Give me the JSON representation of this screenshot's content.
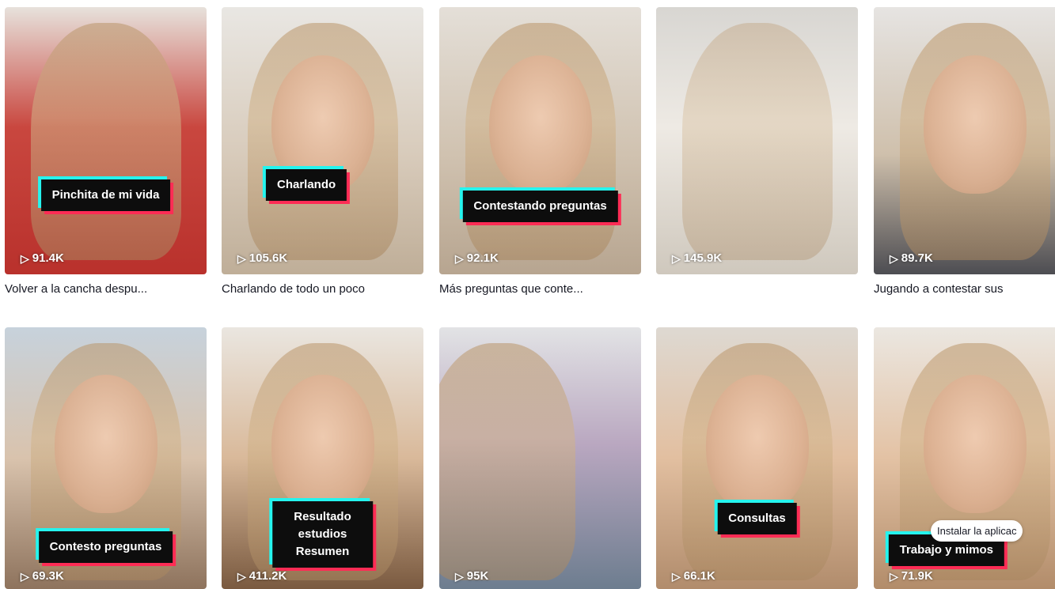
{
  "videos": [
    {
      "sticker": "Pinchita de mi vida",
      "views": "91.4K",
      "desc": "Volver a la cancha despu..."
    },
    {
      "sticker": "Charlando",
      "views": "105.6K",
      "desc": "Charlando de todo un poco"
    },
    {
      "sticker": "Contestando preguntas",
      "views": "92.1K",
      "desc": "Más preguntas que conte..."
    },
    {
      "sticker": "",
      "views": "145.9K",
      "desc": ""
    },
    {
      "sticker": "",
      "views": "89.7K",
      "desc": "Jugando a contestar sus"
    },
    {
      "sticker": "Contesto preguntas",
      "views": "69.3K",
      "desc": ""
    },
    {
      "sticker": "Resultado estudios\nResumen",
      "views": "411.2K",
      "desc": ""
    },
    {
      "sticker": "",
      "views": "95K",
      "desc": ""
    },
    {
      "sticker": "Consultas",
      "views": "66.1K",
      "desc": ""
    },
    {
      "sticker": "Trabajo y mimos",
      "views": "71.9K",
      "desc": ""
    }
  ],
  "install_tooltip": "Instalar la aplicac",
  "icons": {
    "play": "play-outline-icon"
  },
  "colors": {
    "sticker_cyan": "#25f4ee",
    "sticker_red": "#fe2c55",
    "sticker_bg": "#0d0d0d"
  }
}
